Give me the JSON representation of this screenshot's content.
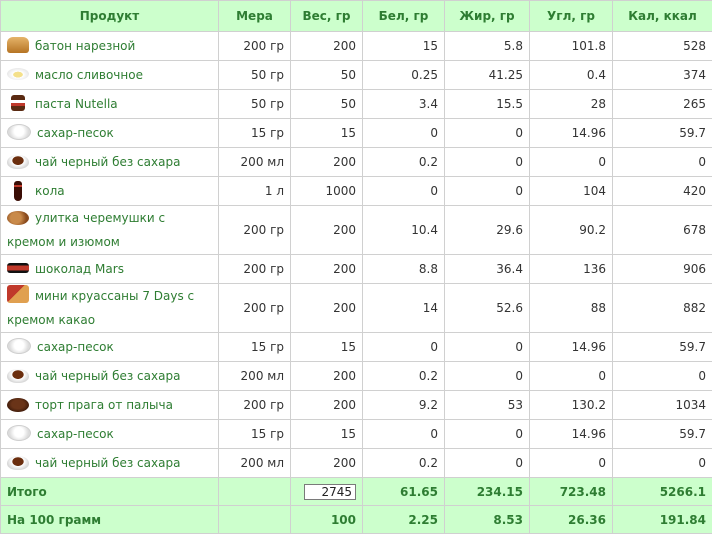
{
  "headers": [
    "Продукт",
    "Мера",
    "Вес, гр",
    "Бел, гр",
    "Жир, гр",
    "Угл, гр",
    "Кал, ккал"
  ],
  "rows": [
    {
      "icon": "bread-icon",
      "name": "батон нарезной",
      "measure": "200 гр",
      "weight": "200",
      "protein": "15",
      "fat": "5.8",
      "carbs": "101.8",
      "kcal": "528"
    },
    {
      "icon": "butter-icon",
      "name": "масло сливочное",
      "measure": "50 гр",
      "weight": "50",
      "protein": "0.25",
      "fat": "41.25",
      "carbs": "0.4",
      "kcal": "374"
    },
    {
      "icon": "nutella-jar-icon",
      "name": "паста Nutella",
      "measure": "50 гр",
      "weight": "50",
      "protein": "3.4",
      "fat": "15.5",
      "carbs": "28",
      "kcal": "265"
    },
    {
      "icon": "sugar-bowl-icon",
      "name": "сахар-песок",
      "measure": "15 гр",
      "weight": "15",
      "protein": "0",
      "fat": "0",
      "carbs": "14.96",
      "kcal": "59.7"
    },
    {
      "icon": "tea-cup-icon",
      "name": "чай черный без сахара",
      "measure": "200 мл",
      "weight": "200",
      "protein": "0.2",
      "fat": "0",
      "carbs": "0",
      "kcal": "0"
    },
    {
      "icon": "cola-bottle-icon",
      "name": "кола",
      "measure": "1 л",
      "weight": "1000",
      "protein": "0",
      "fat": "0",
      "carbs": "104",
      "kcal": "420"
    },
    {
      "icon": "snail-pastry-icon",
      "name": "улитка черемушки с кремом и изюмом",
      "measure": "200 гр",
      "weight": "200",
      "protein": "10.4",
      "fat": "29.6",
      "carbs": "90.2",
      "kcal": "678"
    },
    {
      "icon": "mars-bar-icon",
      "name": "шоколад Mars",
      "measure": "200 гр",
      "weight": "200",
      "protein": "8.8",
      "fat": "36.4",
      "carbs": "136",
      "kcal": "906"
    },
    {
      "icon": "croissant-pack-icon",
      "name": "мини круассаны 7 Days с кремом какао",
      "measure": "200 гр",
      "weight": "200",
      "protein": "14",
      "fat": "52.6",
      "carbs": "88",
      "kcal": "882"
    },
    {
      "icon": "sugar-bowl-icon",
      "name": "сахар-песок",
      "measure": "15 гр",
      "weight": "15",
      "protein": "0",
      "fat": "0",
      "carbs": "14.96",
      "kcal": "59.7"
    },
    {
      "icon": "tea-cup-icon",
      "name": "чай черный без сахара",
      "measure": "200 мл",
      "weight": "200",
      "protein": "0.2",
      "fat": "0",
      "carbs": "0",
      "kcal": "0"
    },
    {
      "icon": "cake-icon",
      "name": "торт прага от палыча",
      "measure": "200 гр",
      "weight": "200",
      "protein": "9.2",
      "fat": "53",
      "carbs": "130.2",
      "kcal": "1034"
    },
    {
      "icon": "sugar-bowl-icon",
      "name": "сахар-песок",
      "measure": "15 гр",
      "weight": "15",
      "protein": "0",
      "fat": "0",
      "carbs": "14.96",
      "kcal": "59.7"
    },
    {
      "icon": "tea-cup-icon",
      "name": "чай черный без сахара",
      "measure": "200 мл",
      "weight": "200",
      "protein": "0.2",
      "fat": "0",
      "carbs": "0",
      "kcal": "0"
    }
  ],
  "total": {
    "label": "Итого",
    "weight": "2745",
    "protein": "61.65",
    "fat": "234.15",
    "carbs": "723.48",
    "kcal": "5266.1"
  },
  "per100": {
    "label": "На 100 грамм",
    "weight": "100",
    "protein": "2.25",
    "fat": "8.53",
    "carbs": "26.36",
    "kcal": "191.84"
  },
  "colors": {
    "header_bg": "#ccffcc",
    "accent_text": "#2e7d32",
    "grid": "#d0d0d0"
  }
}
